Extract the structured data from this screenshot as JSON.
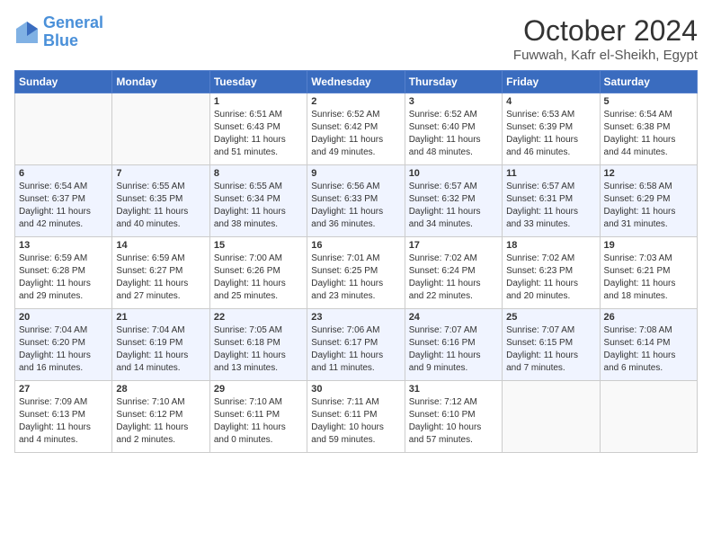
{
  "logo": {
    "text_general": "General",
    "text_blue": "Blue"
  },
  "title": "October 2024",
  "location": "Fuwwah, Kafr el-Sheikh, Egypt",
  "days_header": [
    "Sunday",
    "Monday",
    "Tuesday",
    "Wednesday",
    "Thursday",
    "Friday",
    "Saturday"
  ],
  "weeks": [
    [
      {
        "day": "",
        "lines": []
      },
      {
        "day": "",
        "lines": []
      },
      {
        "day": "1",
        "lines": [
          "Sunrise: 6:51 AM",
          "Sunset: 6:43 PM",
          "Daylight: 11 hours",
          "and 51 minutes."
        ]
      },
      {
        "day": "2",
        "lines": [
          "Sunrise: 6:52 AM",
          "Sunset: 6:42 PM",
          "Daylight: 11 hours",
          "and 49 minutes."
        ]
      },
      {
        "day": "3",
        "lines": [
          "Sunrise: 6:52 AM",
          "Sunset: 6:40 PM",
          "Daylight: 11 hours",
          "and 48 minutes."
        ]
      },
      {
        "day": "4",
        "lines": [
          "Sunrise: 6:53 AM",
          "Sunset: 6:39 PM",
          "Daylight: 11 hours",
          "and 46 minutes."
        ]
      },
      {
        "day": "5",
        "lines": [
          "Sunrise: 6:54 AM",
          "Sunset: 6:38 PM",
          "Daylight: 11 hours",
          "and 44 minutes."
        ]
      }
    ],
    [
      {
        "day": "6",
        "lines": [
          "Sunrise: 6:54 AM",
          "Sunset: 6:37 PM",
          "Daylight: 11 hours",
          "and 42 minutes."
        ]
      },
      {
        "day": "7",
        "lines": [
          "Sunrise: 6:55 AM",
          "Sunset: 6:35 PM",
          "Daylight: 11 hours",
          "and 40 minutes."
        ]
      },
      {
        "day": "8",
        "lines": [
          "Sunrise: 6:55 AM",
          "Sunset: 6:34 PM",
          "Daylight: 11 hours",
          "and 38 minutes."
        ]
      },
      {
        "day": "9",
        "lines": [
          "Sunrise: 6:56 AM",
          "Sunset: 6:33 PM",
          "Daylight: 11 hours",
          "and 36 minutes."
        ]
      },
      {
        "day": "10",
        "lines": [
          "Sunrise: 6:57 AM",
          "Sunset: 6:32 PM",
          "Daylight: 11 hours",
          "and 34 minutes."
        ]
      },
      {
        "day": "11",
        "lines": [
          "Sunrise: 6:57 AM",
          "Sunset: 6:31 PM",
          "Daylight: 11 hours",
          "and 33 minutes."
        ]
      },
      {
        "day": "12",
        "lines": [
          "Sunrise: 6:58 AM",
          "Sunset: 6:29 PM",
          "Daylight: 11 hours",
          "and 31 minutes."
        ]
      }
    ],
    [
      {
        "day": "13",
        "lines": [
          "Sunrise: 6:59 AM",
          "Sunset: 6:28 PM",
          "Daylight: 11 hours",
          "and 29 minutes."
        ]
      },
      {
        "day": "14",
        "lines": [
          "Sunrise: 6:59 AM",
          "Sunset: 6:27 PM",
          "Daylight: 11 hours",
          "and 27 minutes."
        ]
      },
      {
        "day": "15",
        "lines": [
          "Sunrise: 7:00 AM",
          "Sunset: 6:26 PM",
          "Daylight: 11 hours",
          "and 25 minutes."
        ]
      },
      {
        "day": "16",
        "lines": [
          "Sunrise: 7:01 AM",
          "Sunset: 6:25 PM",
          "Daylight: 11 hours",
          "and 23 minutes."
        ]
      },
      {
        "day": "17",
        "lines": [
          "Sunrise: 7:02 AM",
          "Sunset: 6:24 PM",
          "Daylight: 11 hours",
          "and 22 minutes."
        ]
      },
      {
        "day": "18",
        "lines": [
          "Sunrise: 7:02 AM",
          "Sunset: 6:23 PM",
          "Daylight: 11 hours",
          "and 20 minutes."
        ]
      },
      {
        "day": "19",
        "lines": [
          "Sunrise: 7:03 AM",
          "Sunset: 6:21 PM",
          "Daylight: 11 hours",
          "and 18 minutes."
        ]
      }
    ],
    [
      {
        "day": "20",
        "lines": [
          "Sunrise: 7:04 AM",
          "Sunset: 6:20 PM",
          "Daylight: 11 hours",
          "and 16 minutes."
        ]
      },
      {
        "day": "21",
        "lines": [
          "Sunrise: 7:04 AM",
          "Sunset: 6:19 PM",
          "Daylight: 11 hours",
          "and 14 minutes."
        ]
      },
      {
        "day": "22",
        "lines": [
          "Sunrise: 7:05 AM",
          "Sunset: 6:18 PM",
          "Daylight: 11 hours",
          "and 13 minutes."
        ]
      },
      {
        "day": "23",
        "lines": [
          "Sunrise: 7:06 AM",
          "Sunset: 6:17 PM",
          "Daylight: 11 hours",
          "and 11 minutes."
        ]
      },
      {
        "day": "24",
        "lines": [
          "Sunrise: 7:07 AM",
          "Sunset: 6:16 PM",
          "Daylight: 11 hours",
          "and 9 minutes."
        ]
      },
      {
        "day": "25",
        "lines": [
          "Sunrise: 7:07 AM",
          "Sunset: 6:15 PM",
          "Daylight: 11 hours",
          "and 7 minutes."
        ]
      },
      {
        "day": "26",
        "lines": [
          "Sunrise: 7:08 AM",
          "Sunset: 6:14 PM",
          "Daylight: 11 hours",
          "and 6 minutes."
        ]
      }
    ],
    [
      {
        "day": "27",
        "lines": [
          "Sunrise: 7:09 AM",
          "Sunset: 6:13 PM",
          "Daylight: 11 hours",
          "and 4 minutes."
        ]
      },
      {
        "day": "28",
        "lines": [
          "Sunrise: 7:10 AM",
          "Sunset: 6:12 PM",
          "Daylight: 11 hours",
          "and 2 minutes."
        ]
      },
      {
        "day": "29",
        "lines": [
          "Sunrise: 7:10 AM",
          "Sunset: 6:11 PM",
          "Daylight: 11 hours",
          "and 0 minutes."
        ]
      },
      {
        "day": "30",
        "lines": [
          "Sunrise: 7:11 AM",
          "Sunset: 6:11 PM",
          "Daylight: 10 hours",
          "and 59 minutes."
        ]
      },
      {
        "day": "31",
        "lines": [
          "Sunrise: 7:12 AM",
          "Sunset: 6:10 PM",
          "Daylight: 10 hours",
          "and 57 minutes."
        ]
      },
      {
        "day": "",
        "lines": []
      },
      {
        "day": "",
        "lines": []
      }
    ]
  ]
}
